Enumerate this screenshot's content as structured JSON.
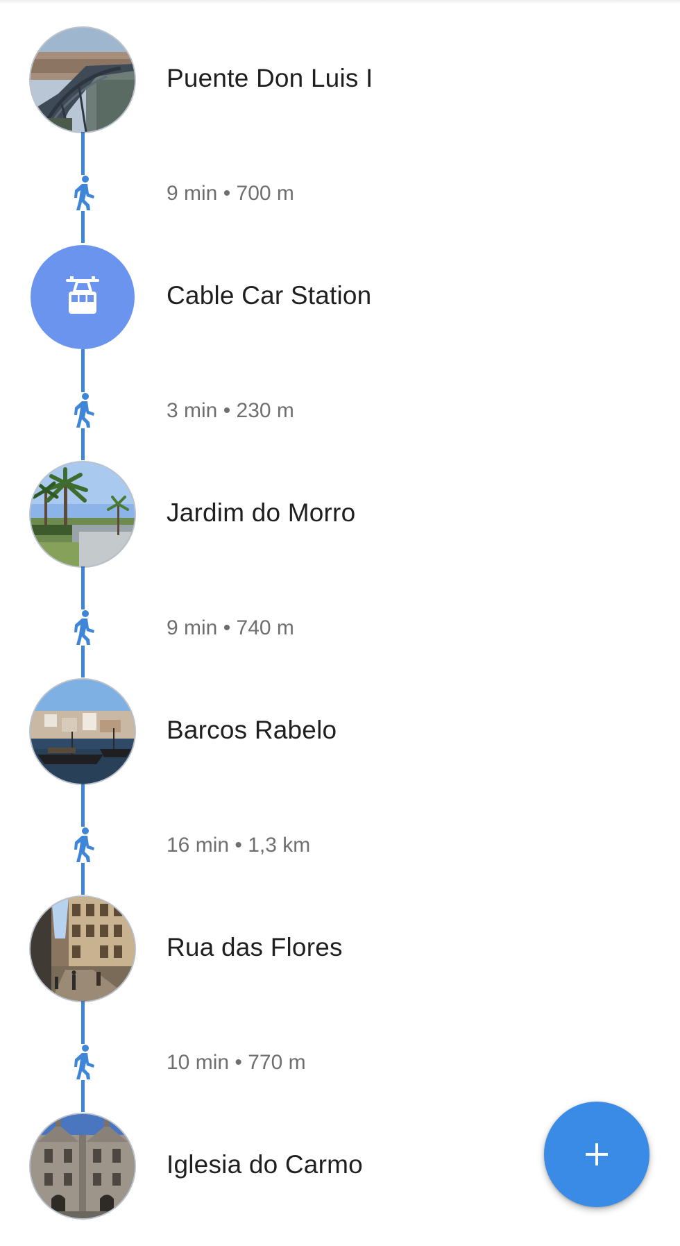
{
  "colors": {
    "route_line": "#3f86d9",
    "cable_car_circle": "#6b94ee",
    "fab": "#3a8be5",
    "title_text": "#1f1f1f",
    "leg_text": "#6f6f6f"
  },
  "stops": [
    {
      "title": "Puente Don Luis I",
      "icon": "bridge-photo"
    },
    {
      "title": "Cable Car Station",
      "icon": "cable-car-icon"
    },
    {
      "title": "Jardim do Morro",
      "icon": "garden-photo"
    },
    {
      "title": "Barcos Rabelo",
      "icon": "boats-photo"
    },
    {
      "title": "Rua das Flores",
      "icon": "street-photo"
    },
    {
      "title": "Iglesia do Carmo",
      "icon": "church-photo"
    }
  ],
  "legs": [
    {
      "mode_icon": "walking-icon",
      "text": "9 min • 700 m"
    },
    {
      "mode_icon": "walking-icon",
      "text": "3 min • 230 m"
    },
    {
      "mode_icon": "walking-icon",
      "text": "9 min • 740 m"
    },
    {
      "mode_icon": "walking-icon",
      "text": "16 min • 1,3 km"
    },
    {
      "mode_icon": "walking-icon",
      "text": "10 min • 770 m"
    }
  ],
  "fab": {
    "icon": "plus-icon"
  }
}
